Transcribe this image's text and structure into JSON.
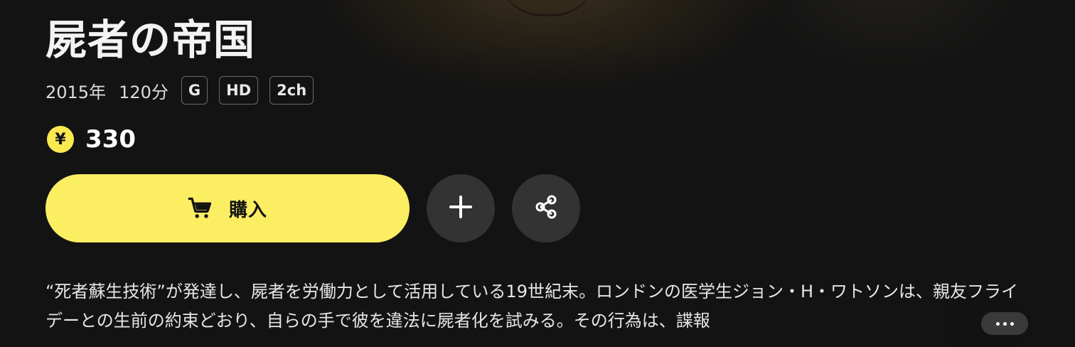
{
  "title": "屍者の帝国",
  "meta": {
    "year": "2015年",
    "duration": "120分",
    "badges": [
      "G",
      "HD",
      "2ch"
    ]
  },
  "price": {
    "currency_symbol": "¥",
    "value": "330"
  },
  "actions": {
    "buy_label": "購入",
    "add_icon": "plus-icon",
    "share_icon": "share-icon",
    "cart_icon": "cart-icon"
  },
  "description": "“死者蘇生技術”が発達し、屍者を労働力として活用している19世紀末。ロンドンの医学生ジョン・H・ワトソンは、親友フライデーとの生前の約束どおり、自らの手で彼を違法に屍者化を試みる。その行為は、諜報",
  "colors": {
    "accent": "#fcee63",
    "background": "#131313",
    "secondary_button": "#333333"
  }
}
